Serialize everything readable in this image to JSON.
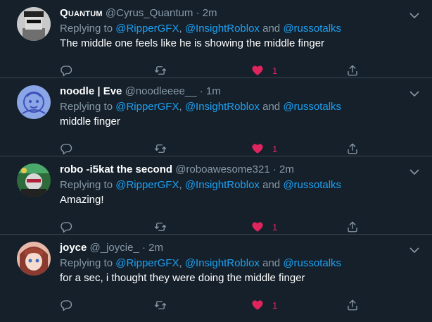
{
  "replies": [
    {
      "display_name": "Quantum",
      "handle": "@Cyrus_Quantum",
      "time": "2m",
      "replying_prefix": "Replying to ",
      "mention_1": "@RipperGFX",
      "sep_1": ", ",
      "mention_2": "@InsightRoblox",
      "sep_2": " and ",
      "mention_3": "@russotalks",
      "text": "The middle one feels like he is showing the middle finger",
      "likes": "1",
      "liked": true
    },
    {
      "display_name": "noodle | Eve",
      "handle": "@noodleeee__",
      "time": "1m",
      "replying_prefix": "Replying to ",
      "mention_1": "@RipperGFX",
      "sep_1": ", ",
      "mention_2": "@InsightRoblox",
      "sep_2": " and ",
      "mention_3": "@russotalks",
      "text": "middle finger",
      "likes": "1",
      "liked": true
    },
    {
      "display_name": "robo -i5kat the second",
      "handle": "@roboawesome321",
      "time": "2m",
      "replying_prefix": "Replying to ",
      "mention_1": "@RipperGFX",
      "sep_1": ", ",
      "mention_2": "@InsightRoblox",
      "sep_2": " and ",
      "mention_3": "@russotalks",
      "text": "Amazing!",
      "likes": "1",
      "liked": true
    },
    {
      "display_name": "joyce",
      "handle": "@_joycie_",
      "time": "2m",
      "replying_prefix": "Replying to ",
      "mention_1": "@RipperGFX",
      "sep_1": ", ",
      "mention_2": "@InsightRoblox",
      "sep_2": " and ",
      "mention_3": "@russotalks",
      "text": "for a sec, i thought they were doing the middle finger",
      "likes": "1",
      "liked": true
    }
  ],
  "separator_dot": "·",
  "colors": {
    "background": "#15202b",
    "border": "#38444d",
    "secondary_text": "#8899a6",
    "link": "#1da1f2",
    "like": "#e0245e"
  },
  "icons": [
    "reply-icon",
    "retweet-icon",
    "heart-icon",
    "share-icon",
    "chevron-down-icon"
  ]
}
